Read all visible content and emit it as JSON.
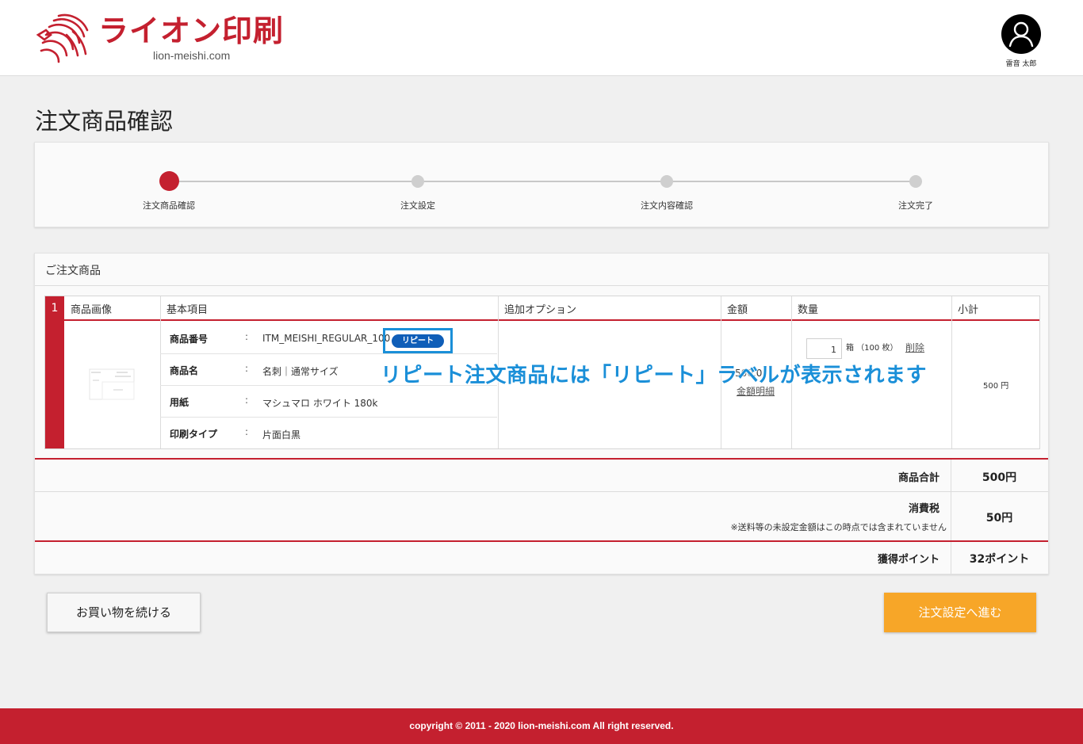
{
  "header": {
    "logo_title": "ライオン印刷",
    "logo_domain": "lion-meishi.com",
    "user_name": "雷音 太郎",
    "brand_color": "#c4202f"
  },
  "page": {
    "title": "注文商品確認"
  },
  "stepper": {
    "steps": [
      {
        "label": "注文商品確認",
        "active": true
      },
      {
        "label": "注文設定",
        "active": false
      },
      {
        "label": "注文内容確認",
        "active": false
      },
      {
        "label": "注文完了",
        "active": false
      }
    ]
  },
  "order": {
    "section_title": "ご注文商品",
    "columns": [
      "商品画像",
      "基本項目",
      "追加オプション",
      "金額",
      "数量",
      "小計"
    ],
    "items": [
      {
        "number": "1",
        "specs": [
          {
            "key": "商品番号",
            "value": "ITM_MEISHI_REGULAR_100"
          },
          {
            "key": "商品名",
            "value": "名刺｜通常サイズ"
          },
          {
            "key": "用紙",
            "value": "マシュマロ ホワイト 180k"
          },
          {
            "key": "印刷タイプ",
            "value": "片面白黒"
          }
        ],
        "spec_separator": ":",
        "repeat_badge": "リピート",
        "price": "500.0",
        "price_detail_link": "金額明細",
        "quantity": "1",
        "quantity_unit": "箱 （100 枚）",
        "delete_link": "削除",
        "subtotal": "500 円"
      }
    ]
  },
  "callout": "リピート注文商品には「リピート」ラベルが表示されます",
  "summary": {
    "product_total_label": "商品合計",
    "product_total_value": "500円",
    "tax_label": "消費税",
    "tax_note": "※送料等の未設定金額はこの時点では含まれていません",
    "tax_value": "50円",
    "points_label": "獲得ポイント",
    "points_value": "32ポイント"
  },
  "buttons": {
    "continue_shopping": "お買い物を続ける",
    "proceed": "注文設定へ進む"
  },
  "footer": {
    "copyright": "copyright © 2011 - 2020 lion-meishi.com All right reserved."
  },
  "icons": {
    "logo": "lion-head-icon",
    "user": "user-avatar-icon"
  }
}
